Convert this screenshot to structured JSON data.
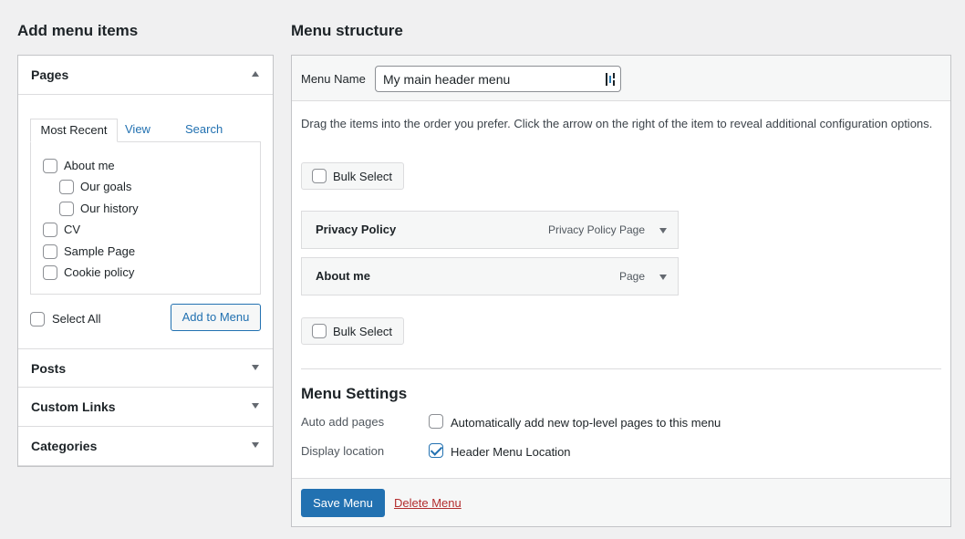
{
  "left": {
    "heading": "Add menu items",
    "pages": {
      "title": "Pages",
      "tabs": [
        "Most Recent",
        "View All",
        "Search"
      ],
      "items": [
        {
          "label": "About me",
          "checked": false
        },
        {
          "label": "Our goals",
          "checked": false
        },
        {
          "label": "Our history",
          "checked": false
        },
        {
          "label": "CV",
          "checked": false
        },
        {
          "label": "Sample Page",
          "checked": false
        },
        {
          "label": "Cookie policy",
          "checked": false
        }
      ],
      "select_all": "Select All",
      "add_button": "Add to Menu"
    },
    "sections": [
      "Posts",
      "Custom Links",
      "Categories"
    ]
  },
  "right": {
    "heading": "Menu structure",
    "menu_name_label": "Menu Name",
    "menu_name_value": "My main header menu",
    "instructions": "Drag the items into the order you prefer. Click the arrow on the right of the item to reveal additional configuration options.",
    "bulk_select": "Bulk Select",
    "menu_items": [
      {
        "title": "Privacy Policy",
        "type": "Privacy Policy Page"
      },
      {
        "title": "About me",
        "type": "Page"
      }
    ],
    "settings": {
      "heading": "Menu Settings",
      "auto_add_label": "Auto add pages",
      "auto_add_option": "Automatically add new top-level pages to this menu",
      "auto_add_checked": false,
      "display_label": "Display location",
      "display_option": "Header Menu Location",
      "display_checked": true
    },
    "save_button": "Save Menu",
    "delete_link": "Delete Menu"
  }
}
